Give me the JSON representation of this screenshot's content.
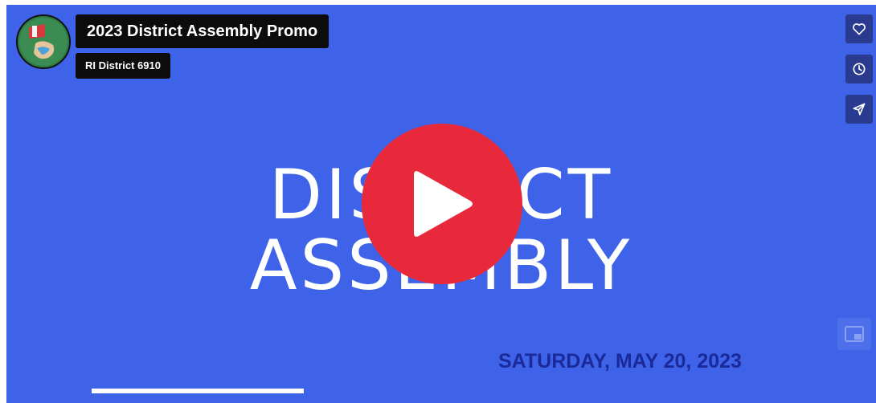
{
  "video": {
    "title": "2023 District Assembly Promo",
    "channel": "RI District 6910",
    "slide_line1": "DISTRICT",
    "slide_line2": "ASSEMBLY",
    "date": "SATURDAY, MAY 20, 2023"
  },
  "side_actions": [
    {
      "icon": "heart-icon"
    },
    {
      "icon": "clock-icon"
    },
    {
      "icon": "send-icon"
    }
  ],
  "colors": {
    "background": "#3e63e9",
    "play_button": "#e8293b",
    "chip": "#0c0c0c",
    "date_text": "#1a2a9a"
  }
}
